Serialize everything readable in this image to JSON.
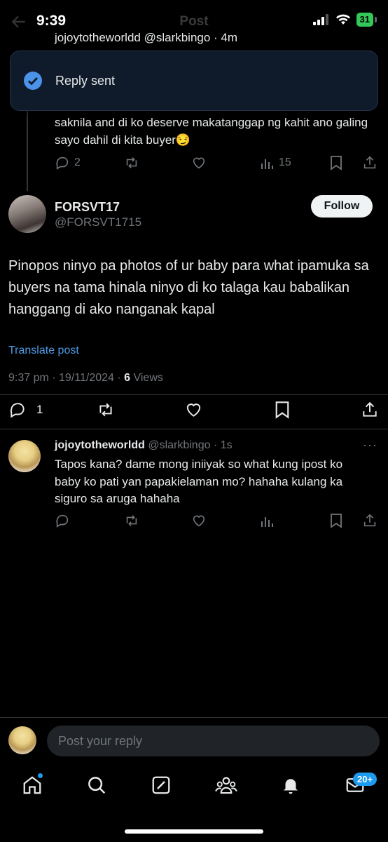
{
  "status_bar": {
    "time": "9:39",
    "battery": "31"
  },
  "header": {
    "title": "Post"
  },
  "toast": {
    "text": "Reply sent"
  },
  "previous_post": {
    "cut_text": "jojoytotheworldd @slarkbingo · 4m",
    "text": "saknila and di ko deserve makatanggap ng kahit ano galing sayo dahil di kita buyer😏",
    "replies": "2",
    "views": "15"
  },
  "main_post": {
    "name": "FORSVT17",
    "handle": "@FORSVT1715",
    "follow_label": "Follow",
    "body": "Pinopos ninyo pa photos of ur baby para what ipamuka sa buyers na tama hinala ninyo di ko talaga kau babalikan hanggang di ako nanganak kapal",
    "translate_label": "Translate post",
    "timestamp": "9:37 pm · 19/11/2024 · ",
    "views_count": "6",
    "views_label": " Views",
    "replies": "1"
  },
  "reply": {
    "name": "jojoytotheworldd",
    "handle": " @slarkbingo · 1s",
    "body": "Tapos kana? dame mong iniiyak so what kung ipost ko baby ko pati yan papakielaman mo? hahaha kulang ka siguro sa aruga hahaha",
    "more": "···"
  },
  "composer": {
    "placeholder": "Post your reply"
  },
  "bottom_nav": {
    "items": [
      "home-icon",
      "search-icon",
      "grok-icon",
      "communities-icon",
      "notifications-icon",
      "messages-icon"
    ],
    "messages_badge": "20+"
  },
  "colors": {
    "accent": "#1d9bf0",
    "link": "#4f9ae6",
    "muted": "#71767b"
  }
}
